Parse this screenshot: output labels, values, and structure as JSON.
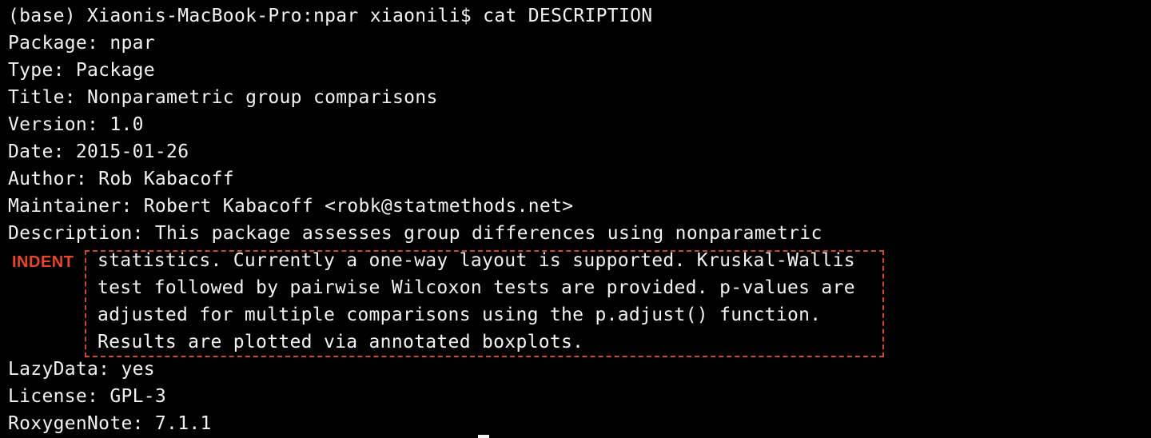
{
  "terminal": {
    "prompt_line": "(base) Xiaonis-MacBook-Pro:npar xiaonili$ cat DESCRIPTION",
    "lines": [
      "Package: npar",
      "Type: Package",
      "Title: Nonparametric group comparisons",
      "Version: 1.0",
      "Date: 2015-01-26",
      "Author: Rob Kabacoff",
      "Maintainer: Robert Kabacoff <robk@statmethods.net>",
      "Description: This package assesses group differences using nonparametric"
    ],
    "description_continuation": [
      "statistics. Currently a one-way layout is supported. Kruskal-Wallis",
      "test followed by pairwise Wilcoxon tests are provided. p-values are",
      "adjusted for multiple comparisons using the p.adjust() function.",
      "Results are plotted via annotated boxplots."
    ],
    "trailing_lines": [
      "LazyData: yes",
      "License: GPL-3",
      "RoxygenNote: 7.1.1"
    ]
  },
  "annotation": {
    "label": "INDENT",
    "color": "#e8452a"
  },
  "colors": {
    "background": "#000000",
    "text": "#f2f2f2"
  }
}
